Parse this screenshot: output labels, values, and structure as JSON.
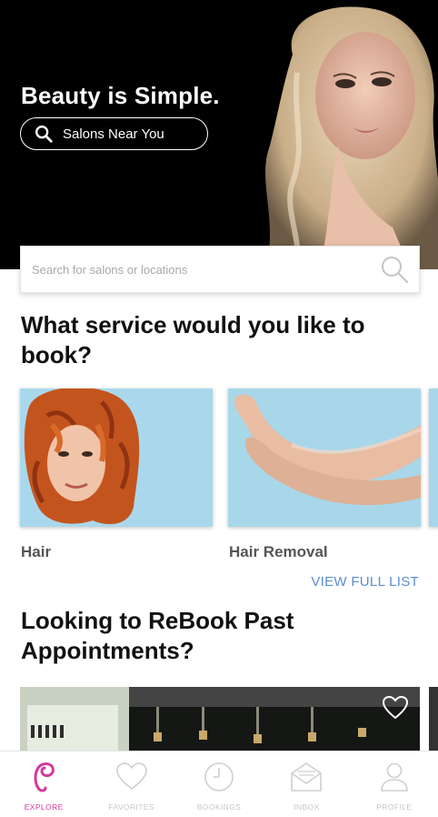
{
  "hero": {
    "title": "Beauty is Simple.",
    "near_button_label": "Salons Near You"
  },
  "search": {
    "placeholder": "Search for salons or locations"
  },
  "services": {
    "heading": "What service would you like to book?",
    "items": [
      {
        "label": "Hair"
      },
      {
        "label": "Hair Removal"
      }
    ],
    "view_full_list": "VIEW FULL LIST"
  },
  "rebook": {
    "heading": "Looking to ReBook Past Appointments?"
  },
  "tabbar": {
    "tabs": [
      {
        "label": "EXPLORE",
        "icon": "explore-logo-icon",
        "active": true
      },
      {
        "label": "FAVORITES",
        "icon": "heart-icon",
        "active": false
      },
      {
        "label": "BOOKINGS",
        "icon": "clock-icon",
        "active": false
      },
      {
        "label": "INBOX",
        "icon": "envelope-icon",
        "active": false
      },
      {
        "label": "PROFILE",
        "icon": "person-icon",
        "active": false
      }
    ]
  },
  "colors": {
    "accent": "#d2399a",
    "link": "#5b8dd0",
    "inactive": "#c7c7c7"
  }
}
